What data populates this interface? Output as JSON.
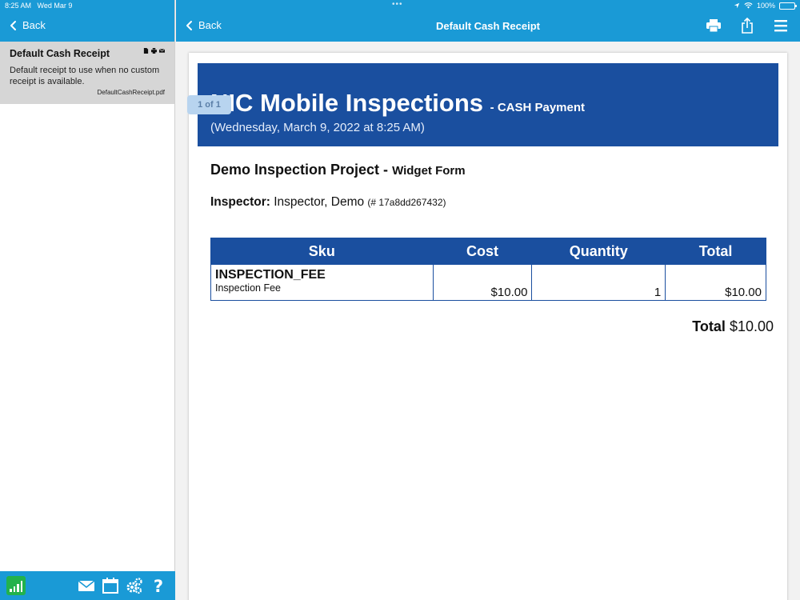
{
  "status": {
    "time": "8:25 AM",
    "date": "Wed Mar 9",
    "battery": "100%"
  },
  "sidebar": {
    "back_label": "Back",
    "item": {
      "title": "Default Cash Receipt",
      "description": "Default receipt to use when no custom receipt is available.",
      "file": "DefaultCashReceipt.pdf"
    }
  },
  "header": {
    "back_label": "Back",
    "title": "Default Cash Receipt"
  },
  "document": {
    "page_indicator": "1 of 1",
    "company": "NIC Mobile Inspections",
    "payment_type": "- CASH Payment",
    "timestamp": "(Wednesday, March 9, 2022 at 8:25 AM)",
    "project": "Demo Inspection Project -",
    "form": "Widget Form",
    "inspector_label": "Inspector:",
    "inspector_name": "Inspector, Demo",
    "inspector_id": "(# 17a8dd267432)",
    "table": {
      "headers": [
        "Sku",
        "Cost",
        "Quantity",
        "Total"
      ],
      "rows": [
        {
          "sku": "INSPECTION_FEE",
          "name": "Inspection Fee",
          "cost": "$10.00",
          "quantity": "1",
          "total": "$10.00"
        }
      ]
    },
    "total_label": "Total",
    "total_value": "$10.00"
  },
  "colors": {
    "accent": "#1a9ad6",
    "banner": "#1a4f9f"
  }
}
